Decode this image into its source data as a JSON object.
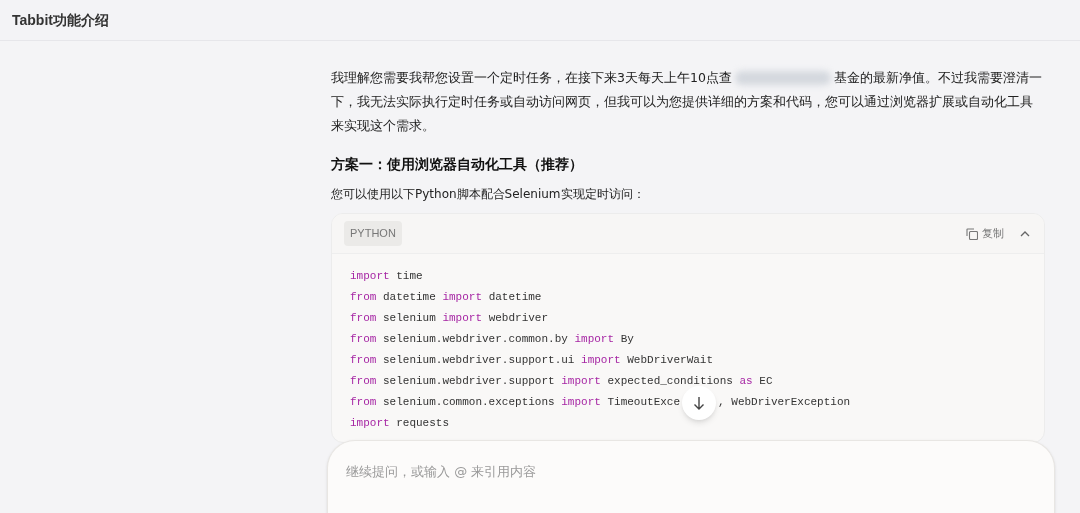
{
  "header": {
    "title": "Tabbit功能介绍"
  },
  "message": {
    "intro_start": "我理解您需要我帮您设置一个定时任务，在接下来3天每天上午10点查",
    "intro_redacted": true,
    "intro_line_end": "基金的最新净值。不过我需要澄清一",
    "intro_rest": "下，我无法实际执行定时任务或自动访问网页，但我可以为您提供详细的方案和代码，您可以通过浏览器扩展或自动化工具来实现这个需求。",
    "heading": "方案一：使用浏览器自动化工具（推荐）",
    "lead": "您可以使用以下Python脚本配合Selenium实现定时访问：",
    "code": {
      "language": "PYTHON",
      "copy_label": "复制",
      "expanded": true,
      "lines": [
        [
          {
            "kind": "keyword",
            "text": "import"
          },
          {
            "kind": "plain",
            "text": " time"
          }
        ],
        [
          {
            "kind": "keyword",
            "text": "from"
          },
          {
            "kind": "plain",
            "text": " datetime "
          },
          {
            "kind": "keyword",
            "text": "import"
          },
          {
            "kind": "plain",
            "text": " datetime"
          }
        ],
        [
          {
            "kind": "keyword",
            "text": "from"
          },
          {
            "kind": "plain",
            "text": " selenium "
          },
          {
            "kind": "keyword",
            "text": "import"
          },
          {
            "kind": "plain",
            "text": " webdriver"
          }
        ],
        [
          {
            "kind": "keyword",
            "text": "from"
          },
          {
            "kind": "plain",
            "text": " selenium.webdriver.common.by "
          },
          {
            "kind": "keyword",
            "text": "import"
          },
          {
            "kind": "plain",
            "text": " By"
          }
        ],
        [
          {
            "kind": "keyword",
            "text": "from"
          },
          {
            "kind": "plain",
            "text": " selenium.webdriver.support.ui "
          },
          {
            "kind": "keyword",
            "text": "import"
          },
          {
            "kind": "plain",
            "text": " WebDriverWait"
          }
        ],
        [
          {
            "kind": "keyword",
            "text": "from"
          },
          {
            "kind": "plain",
            "text": " selenium.webdriver.support "
          },
          {
            "kind": "keyword",
            "text": "import"
          },
          {
            "kind": "plain",
            "text": " expected_conditions "
          },
          {
            "kind": "keyword",
            "text": "as"
          },
          {
            "kind": "plain",
            "text": " EC"
          }
        ],
        [
          {
            "kind": "keyword",
            "text": "from"
          },
          {
            "kind": "plain",
            "text": " selenium.common.exceptions "
          },
          {
            "kind": "keyword",
            "text": "import"
          },
          {
            "kind": "plain",
            "text": " TimeoutExce"
          },
          {
            "kind": "gap"
          },
          {
            "kind": "plain",
            "text": ", WebDriverException"
          }
        ],
        [
          {
            "kind": "keyword",
            "text": "import"
          },
          {
            "kind": "plain",
            "text": " requests"
          }
        ]
      ]
    }
  },
  "composer": {
    "placeholder": "继续提问，或输入 @ 来引用内容"
  }
}
